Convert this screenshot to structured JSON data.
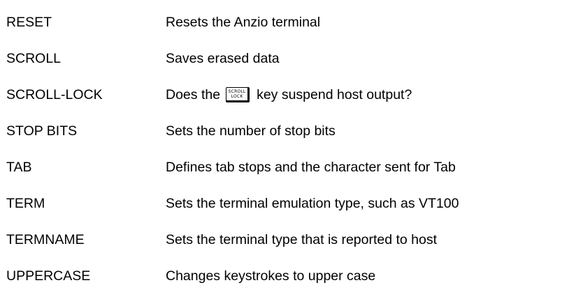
{
  "commands": [
    {
      "name": "RESET",
      "description": "Resets the Anzio terminal"
    },
    {
      "name": "SCROLL",
      "description": "Saves erased data"
    },
    {
      "name": "SCROLL-LOCK",
      "description_before": "Does the",
      "key": {
        "line1": "SCROLL",
        "line2": "LOCK"
      },
      "description_after": "key suspend host output?"
    },
    {
      "name": "STOP BITS",
      "description": "Sets the number of stop bits"
    },
    {
      "name": "TAB",
      "description": "Defines tab stops and the character sent for Tab"
    },
    {
      "name": "TERM",
      "description": "Sets the terminal emulation type, such as VT100"
    },
    {
      "name": "TERMNAME",
      "description": "Sets the terminal type that is reported to host"
    },
    {
      "name": "UPPERCASE",
      "description": "Changes keystrokes to upper case"
    }
  ]
}
